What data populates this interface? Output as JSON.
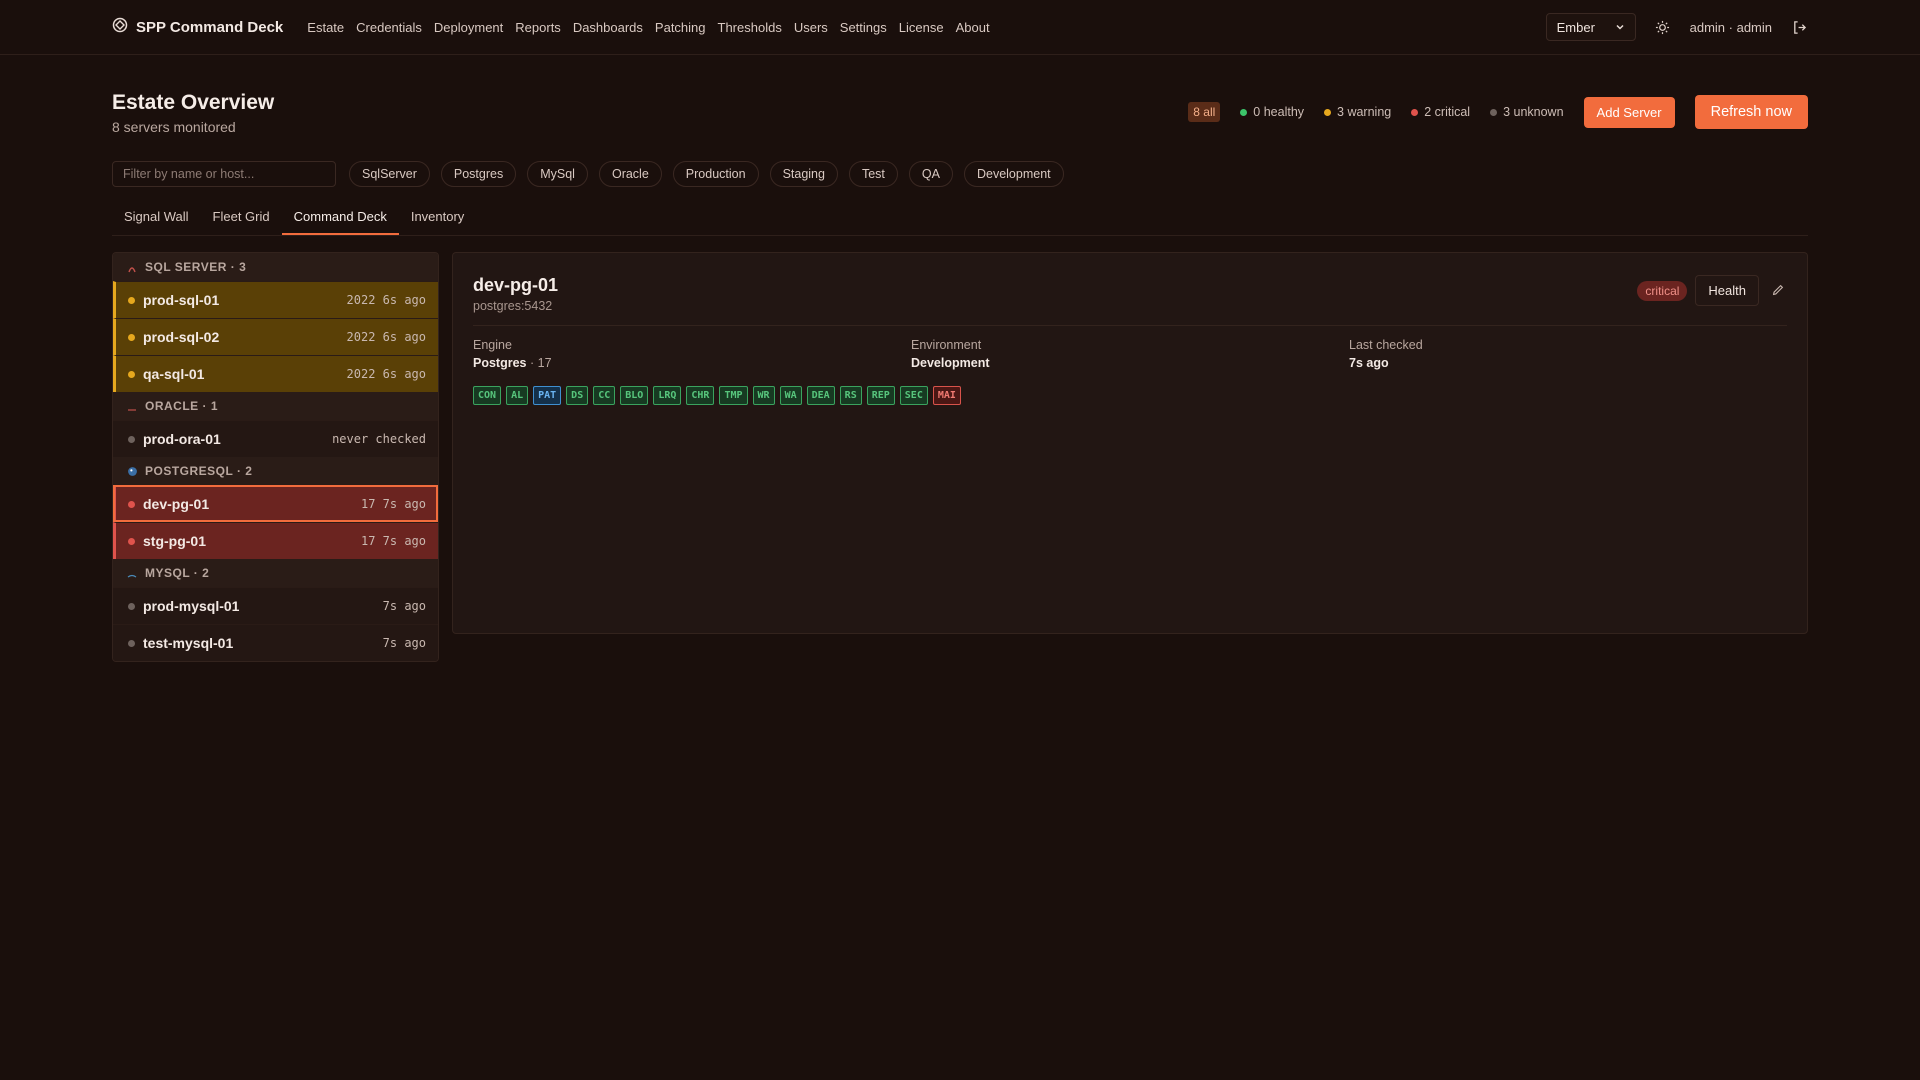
{
  "app": {
    "title": "SPP Command Deck"
  },
  "nav": [
    "Estate",
    "Credentials",
    "Deployment",
    "Reports",
    "Dashboards",
    "Patching",
    "Thresholds",
    "Users",
    "Settings",
    "License",
    "About"
  ],
  "topbar": {
    "theme": "Ember",
    "user": "admin · admin"
  },
  "page": {
    "title": "Estate Overview",
    "subtitle": "8 servers monitored"
  },
  "stats": {
    "all": "8 all",
    "healthy": "0 healthy",
    "warning": "3 warning",
    "critical": "2 critical",
    "unknown": "3 unknown"
  },
  "actions": {
    "add": "Add Server",
    "refresh": "Refresh now"
  },
  "filter": {
    "placeholder": "Filter by name or host...",
    "chips": [
      "SqlServer",
      "Postgres",
      "MySql",
      "Oracle",
      "Production",
      "Staging",
      "Test",
      "QA",
      "Development"
    ]
  },
  "tabs": [
    "Signal Wall",
    "Fleet Grid",
    "Command Deck",
    "Inventory"
  ],
  "active_tab": "Command Deck",
  "groups": [
    {
      "label": "SQL SERVER · 3",
      "icon": "sqlserver-icon",
      "servers": [
        {
          "name": "prod-sql-01",
          "meta": "2022 6s ago",
          "status": "warning"
        },
        {
          "name": "prod-sql-02",
          "meta": "2022 6s ago",
          "status": "warning"
        },
        {
          "name": "qa-sql-01",
          "meta": "2022 6s ago",
          "status": "warning"
        }
      ]
    },
    {
      "label": "ORACLE · 1",
      "icon": "oracle-icon",
      "servers": [
        {
          "name": "prod-ora-01",
          "meta": "never checked",
          "status": "unknown"
        }
      ]
    },
    {
      "label": "POSTGRESQL · 2",
      "icon": "postgresql-icon",
      "servers": [
        {
          "name": "dev-pg-01",
          "meta": "17 7s ago",
          "status": "critical",
          "selected": true
        },
        {
          "name": "stg-pg-01",
          "meta": "17 7s ago",
          "status": "critical"
        }
      ]
    },
    {
      "label": "MYSQL · 2",
      "icon": "mysql-icon",
      "servers": [
        {
          "name": "prod-mysql-01",
          "meta": "7s ago",
          "status": "unknown"
        },
        {
          "name": "test-mysql-01",
          "meta": "7s ago",
          "status": "unknown"
        }
      ]
    }
  ],
  "detail": {
    "name": "dev-pg-01",
    "host": "postgres:5432",
    "badge": "critical",
    "health_button": "Health",
    "engine_label": "Engine",
    "engine": "Postgres",
    "engine_version": "·  17",
    "environment_label": "Environment",
    "environment": "Development",
    "last_checked_label": "Last checked",
    "last_checked": "7s  ago",
    "checks": [
      {
        "code": "CON",
        "state": "ok"
      },
      {
        "code": "AL",
        "state": "ok"
      },
      {
        "code": "PAT",
        "state": "info"
      },
      {
        "code": "DS",
        "state": "ok"
      },
      {
        "code": "CC",
        "state": "ok"
      },
      {
        "code": "BLO",
        "state": "ok"
      },
      {
        "code": "LRQ",
        "state": "ok"
      },
      {
        "code": "CHR",
        "state": "ok"
      },
      {
        "code": "TMP",
        "state": "ok"
      },
      {
        "code": "WR",
        "state": "ok"
      },
      {
        "code": "WA",
        "state": "ok"
      },
      {
        "code": "DEA",
        "state": "ok"
      },
      {
        "code": "RS",
        "state": "ok"
      },
      {
        "code": "REP",
        "state": "ok"
      },
      {
        "code": "SEC",
        "state": "ok"
      },
      {
        "code": "MAI",
        "state": "fail"
      }
    ]
  },
  "colors": {
    "accent": "#f26c3d",
    "healthy": "#3cc46a",
    "warning": "#e6a81e",
    "critical": "#e0534c",
    "unknown": "#6e625d"
  }
}
